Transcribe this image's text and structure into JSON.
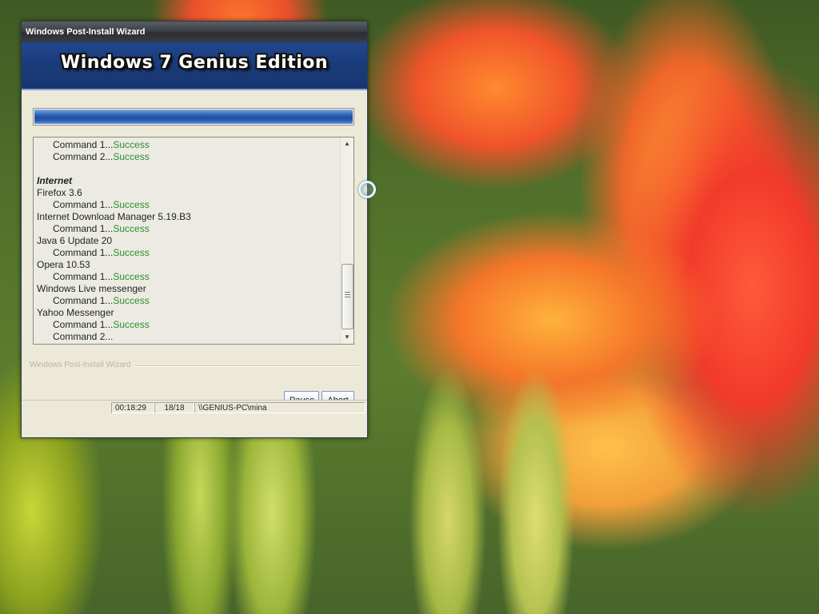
{
  "window": {
    "title": "Windows Post-Install Wizard",
    "banner_title": "Windows 7 Genius Edition"
  },
  "progress": {
    "fraction": 1.0
  },
  "log": {
    "lines": [
      {
        "text": "Command 1...",
        "status": "Success",
        "indent": true
      },
      {
        "text": "Command 2...",
        "status": "Success",
        "indent": true
      },
      {
        "text": "",
        "blank": true
      },
      {
        "text": "Internet",
        "category": true
      },
      {
        "text": "Firefox 3.6"
      },
      {
        "text": "Command 1...",
        "status": "Success",
        "indent": true
      },
      {
        "text": "Internet Download Manager 5.19.B3"
      },
      {
        "text": "Command 1...",
        "status": "Success",
        "indent": true
      },
      {
        "text": "Java 6 Update 20"
      },
      {
        "text": "Command 1...",
        "status": "Success",
        "indent": true
      },
      {
        "text": "Opera 10.53"
      },
      {
        "text": "Command 1...",
        "status": "Success",
        "indent": true
      },
      {
        "text": "Windows Live messenger"
      },
      {
        "text": "Command 1...",
        "status": "Success",
        "indent": true
      },
      {
        "text": "Yahoo Messenger"
      },
      {
        "text": "Command 1...",
        "status": "Success",
        "indent": true
      },
      {
        "text": "Command 2...",
        "indent": true
      }
    ]
  },
  "group_label": "Windows Post-Install Wizard",
  "buttons": {
    "pause": "Pause",
    "abort": "Abort"
  },
  "status": {
    "elapsed": "00:18:29",
    "count": "18/18",
    "user": "\\\\GENIUS-PC\\mina"
  },
  "colors": {
    "success": "#2e8b2e",
    "banner": "#1a3a79"
  }
}
